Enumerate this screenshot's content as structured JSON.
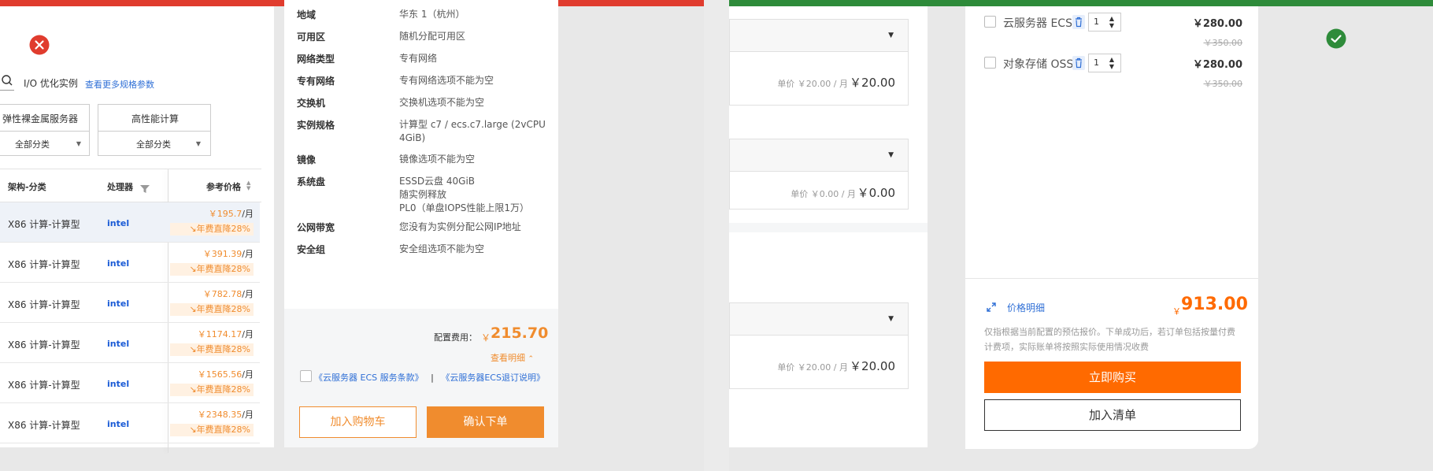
{
  "colors": {
    "error_bar": "#e03c2e",
    "success_bar": "#2e8b3a",
    "accent_orange": "#ff6a00",
    "price_orange": "#f08c2e",
    "link_blue": "#2f6fd6"
  },
  "left": {
    "status_icon": "close-circle-icon",
    "filter": {
      "search_icon": "search-icon",
      "io_label": "I/O 优化实例",
      "more_specs_link": "查看更多规格参数"
    },
    "categories": [
      {
        "label": "弹性裸金属服务器",
        "select_value": "全部分类"
      },
      {
        "label": "高性能计算",
        "select_value": "全部分类"
      }
    ],
    "table": {
      "headers": {
        "arch": "架构-分类",
        "cpu": "处理器",
        "price": "参考价格"
      },
      "rows": [
        {
          "arch": "X86 计算-计算型",
          "cpu": "intel",
          "price": "￥195.7",
          "unit": "/月",
          "discount": "↘年费直降28%"
        },
        {
          "arch": "X86 计算-计算型",
          "cpu": "intel",
          "price": "￥391.39",
          "unit": "/月",
          "discount": "↘年费直降28%"
        },
        {
          "arch": "X86 计算-计算型",
          "cpu": "intel",
          "price": "￥782.78",
          "unit": "/月",
          "discount": "↘年费直降28%"
        },
        {
          "arch": "X86 计算-计算型",
          "cpu": "intel",
          "price": "￥1174.17",
          "unit": "/月",
          "discount": "↘年费直降28%"
        },
        {
          "arch": "X86 计算-计算型",
          "cpu": "intel",
          "price": "￥1565.56",
          "unit": "/月",
          "discount": "↘年费直降28%"
        },
        {
          "arch": "X86 计算-计算型",
          "cpu": "intel",
          "price": "￥2348.35",
          "unit": "/月",
          "discount": "↘年费直降28%"
        }
      ]
    },
    "summary": {
      "items": [
        {
          "key": "地域",
          "value": "华东 1（杭州）",
          "error": false
        },
        {
          "key": "可用区",
          "value": "随机分配可用区",
          "error": false
        },
        {
          "key": "网络类型",
          "value": "专有网络",
          "error": false
        },
        {
          "key": "专有网络",
          "value": "专有网络选项不能为空",
          "error": true
        },
        {
          "key": "交换机",
          "value": "交换机选项不能为空",
          "error": true
        },
        {
          "key": "实例规格",
          "value": "计算型 c7 / ecs.c7.large (2vCPU 4GiB)",
          "error": false
        },
        {
          "key": "镜像",
          "value": "镜像选项不能为空",
          "error": true
        },
        {
          "key": "系统盘",
          "value_lines": [
            "ESSD云盘 40GiB",
            "随实例释放",
            "PL0（单盘IOPS性能上限1万）"
          ],
          "error": false
        },
        {
          "key": "公网带宽",
          "value": "您没有为实例分配公网IP地址",
          "error": false
        },
        {
          "key": "安全组",
          "value": "安全组选项不能为空",
          "error": true
        }
      ],
      "fee_label": "配置费用：",
      "fee_currency": "￥",
      "fee_value": "215.70",
      "detail_link": "查看明细",
      "agreement_text1": "《云服务器 ECS 服务条款》",
      "agreement_sep": "|",
      "agreement_text2": "《云服务器ECS退订说明》",
      "add_cart_button": "加入购物车",
      "confirm_button": "确认下单"
    }
  },
  "right": {
    "status_icon": "check-circle-icon",
    "config_rows": [
      {
        "unit_price": "单价 ￥20.00 / 月",
        "price": "￥20.00"
      },
      {
        "unit_price": "单价 ￥0.00 / 月",
        "price": "￥0.00"
      },
      {
        "unit_price": "单价 ￥20.00 / 月",
        "price": "￥20.00"
      }
    ],
    "cart": {
      "items": [
        {
          "name": "云服务器 ECS",
          "qty": "1",
          "price": "￥280.00",
          "original": "￥350.00"
        },
        {
          "name": "对象存储 OSS",
          "qty": "1",
          "price": "￥280.00",
          "original": "￥350.00"
        }
      ],
      "price_detail_link": "价格明细",
      "total_currency": "￥",
      "total": "913.00",
      "note": "仅指根据当前配置的预估报价。下单成功后，若订单包括按量付费计费项，实际账单将按照实际使用情况收费",
      "buy_now_button": "立即购买",
      "add_list_button": "加入清单"
    }
  }
}
